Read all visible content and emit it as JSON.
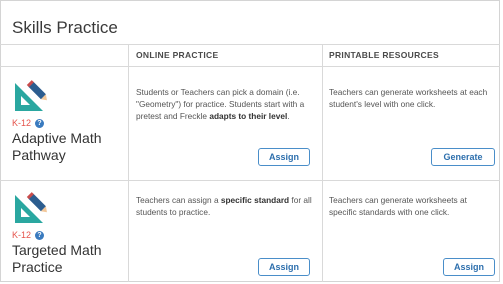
{
  "page": {
    "title": "Skills Practice"
  },
  "columns": {
    "online": "ONLINE PRACTICE",
    "printable": "PRINTABLE RESOURCES"
  },
  "icon": "geometry-tools-icon",
  "colors": {
    "grade": "#e5534b",
    "accent": "#2aa7a0",
    "button": "#2d6fad"
  },
  "rows": [
    {
      "grade": "K-12",
      "name": "Adaptive Math Pathway",
      "online_desc": {
        "p1": "Students or Teachers can pick a domain (i.e. \"Geometry\") for practice. Students start with a pretest and Freckle ",
        "bold": "adapts to their level",
        "p2": "."
      },
      "online_button": "Assign",
      "printable_desc": "Teachers can generate worksheets at each student's level with one click.",
      "printable_button": "Generate"
    },
    {
      "grade": "K-12",
      "name": "Targeted Math Practice",
      "online_desc": {
        "p1": "Teachers can assign a ",
        "bold": "specific standard",
        "p2": " for all students to practice."
      },
      "online_button": "Assign",
      "printable_desc": "Teachers can generate worksheets at specific standards with one click.",
      "printable_button": "Assign"
    }
  ]
}
